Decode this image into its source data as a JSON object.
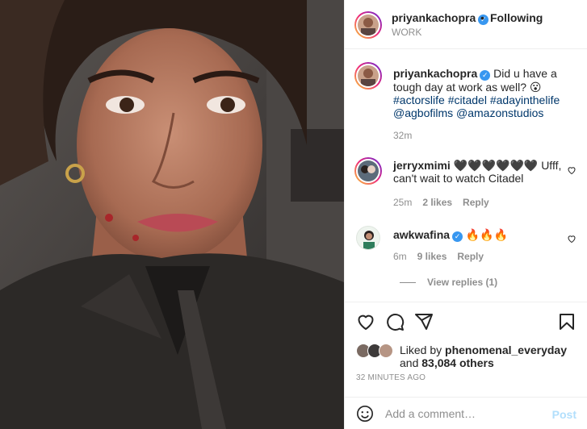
{
  "post": {
    "author": "priyankachopra",
    "following_label": "Following",
    "location": "WORK",
    "dot": "•"
  },
  "caption": {
    "username": "priyankachopra",
    "text": "Did u have a tough day at work as well? 😮",
    "hashtags": "#actorslife #citadel #adayinthelife",
    "mentions": "@agbofilms @amazonstudios",
    "time": "32m"
  },
  "comments": [
    {
      "username": "jerryxmimi",
      "text": "🖤🖤🖤🖤🖤🖤 Ufff, can't wait to watch Citadel",
      "time": "25m",
      "likes": "2 likes",
      "reply": "Reply"
    },
    {
      "username": "awkwafina",
      "text": "🔥🔥🔥",
      "time": "6m",
      "likes": "9 likes",
      "reply": "Reply"
    }
  ],
  "view_replies": "View replies (1)",
  "likes": {
    "prefix": "Liked by ",
    "liker": "phenomenal_everyday",
    "middle": " and ",
    "count": "83,084 others"
  },
  "timestamp": "32 MINUTES AGO",
  "add_comment": {
    "placeholder": "Add a comment…",
    "post_label": "Post"
  },
  "icons": {
    "like": "heart-icon",
    "comment": "comment-icon",
    "share": "share-icon",
    "save": "bookmark-icon",
    "emoji": "emoji-icon",
    "verified": "verified-badge-icon"
  },
  "colors": {
    "link": "#00376b",
    "verified": "#3897f0",
    "muted": "#8e8e8e",
    "post_button": "#b2dffc"
  }
}
